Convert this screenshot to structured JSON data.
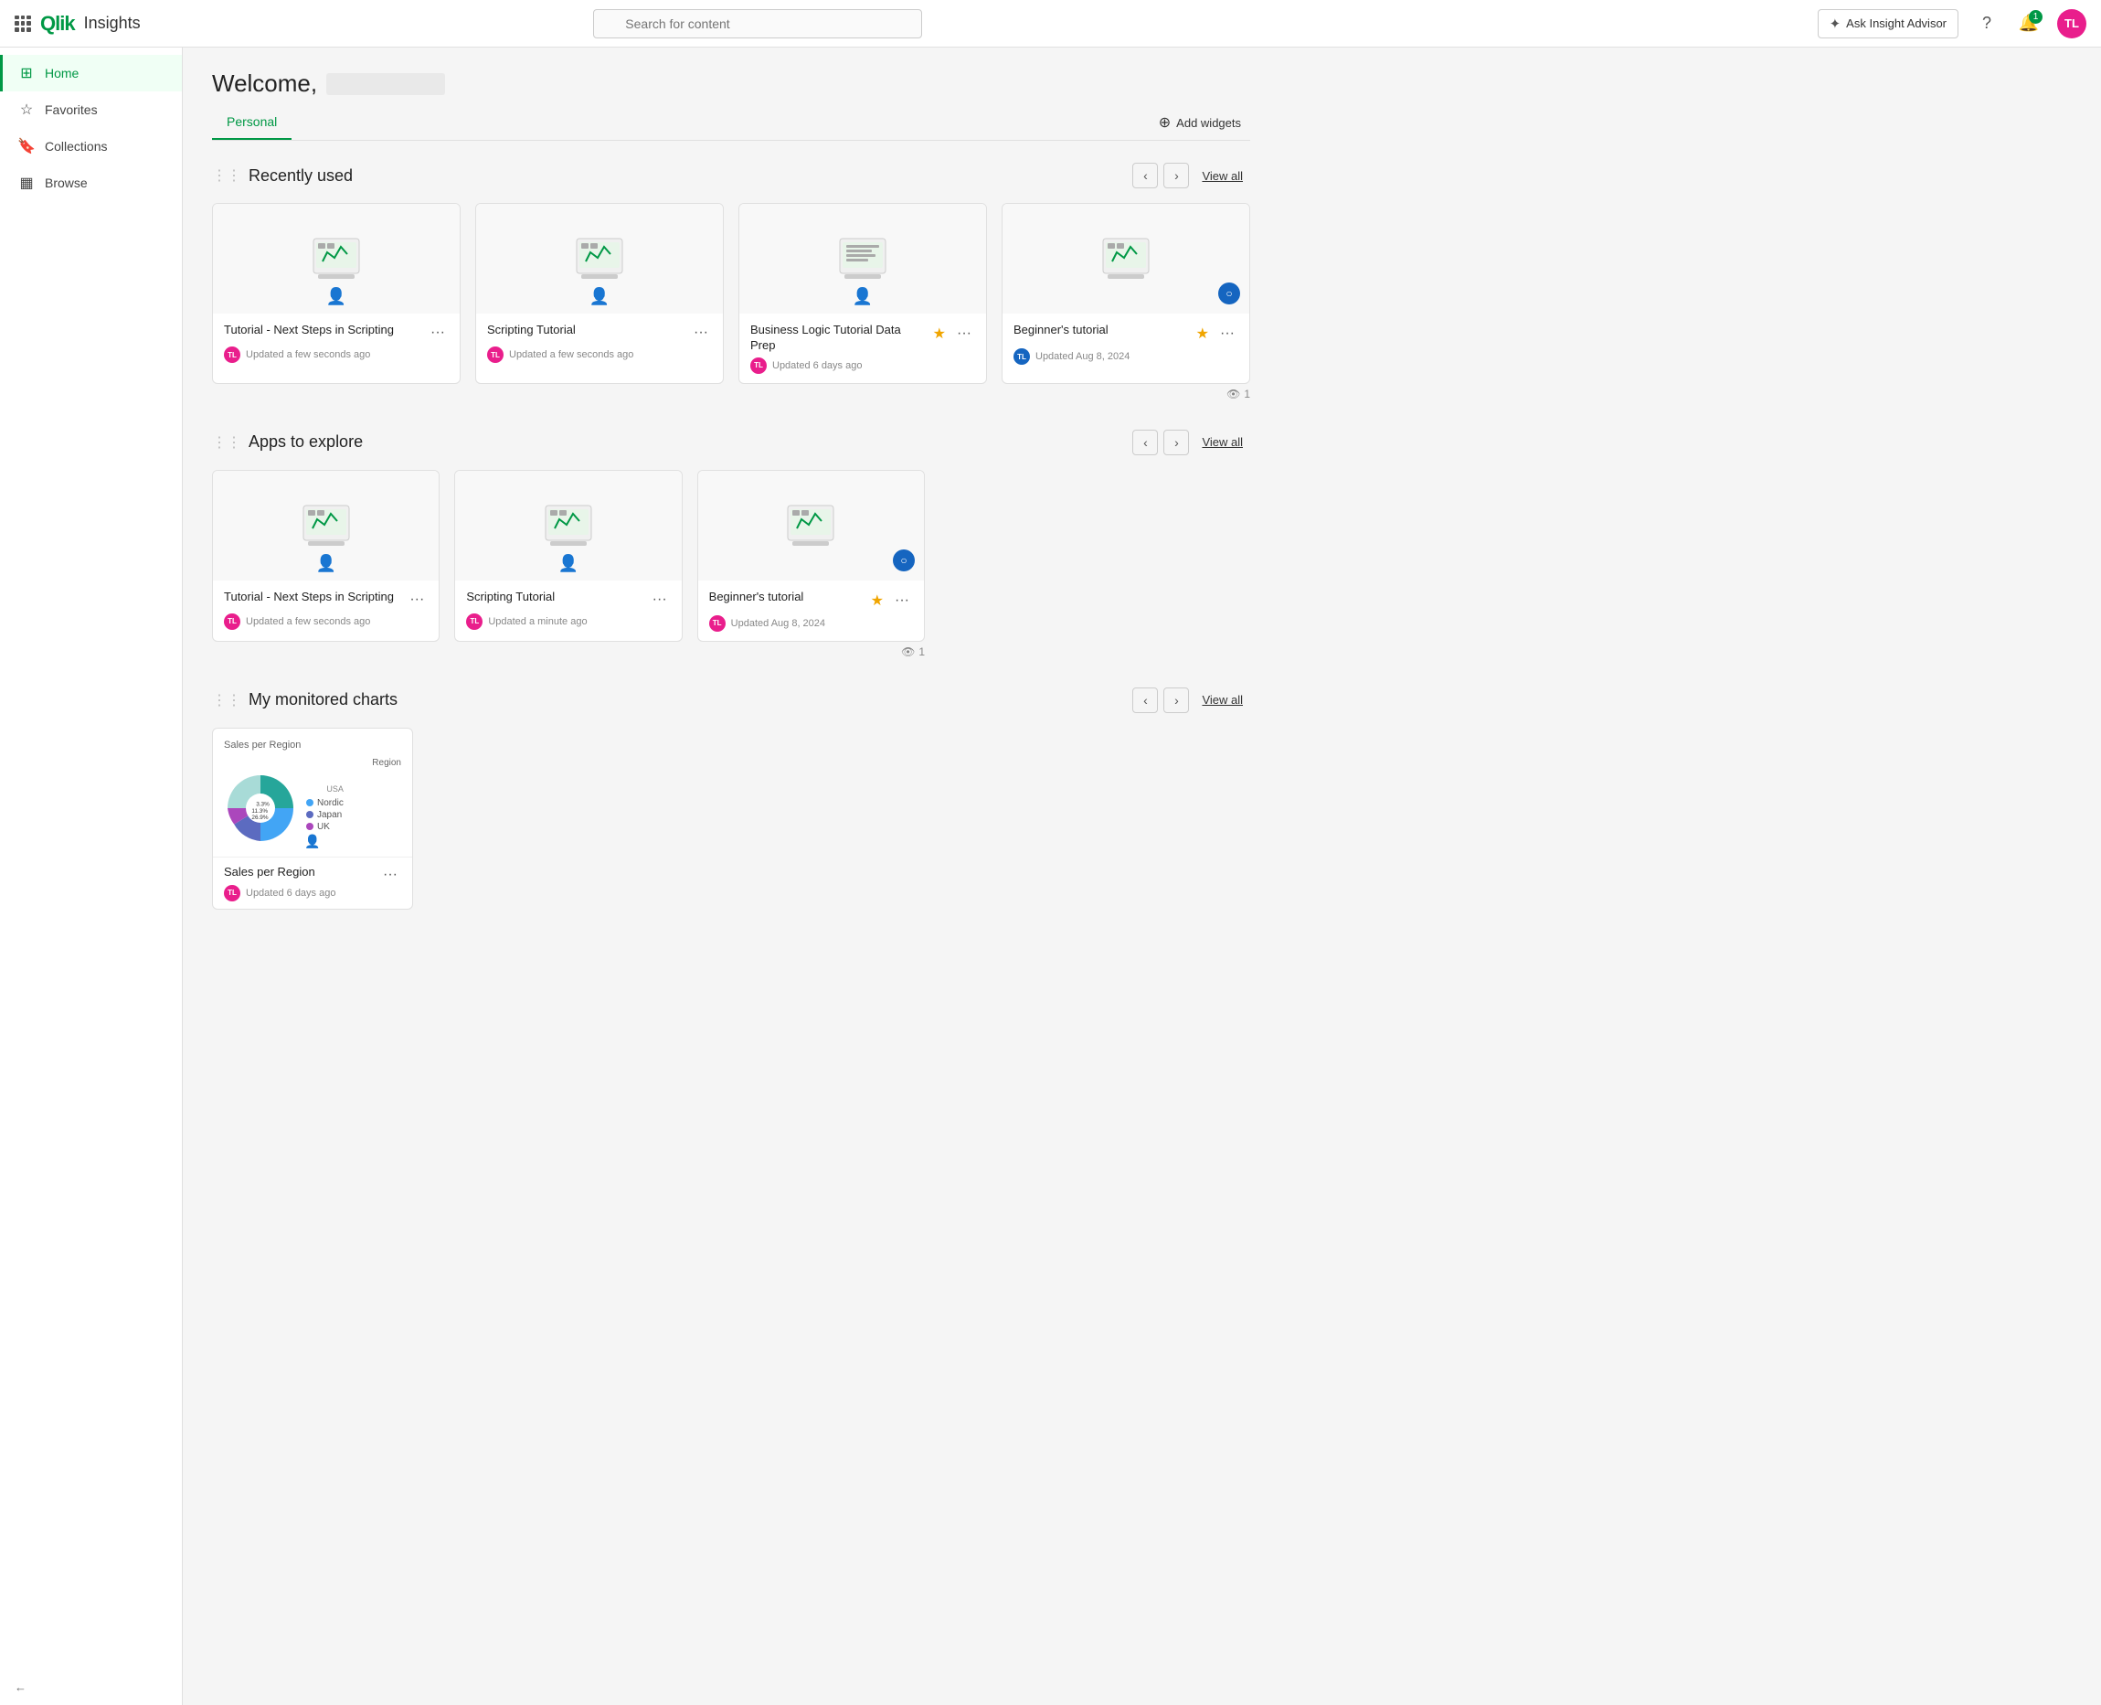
{
  "topbar": {
    "app_title": "Insights",
    "search_placeholder": "Search for content",
    "ask_advisor_label": "Ask Insight Advisor",
    "notif_count": "1",
    "avatar_initials": "TL",
    "help_icon": "question-mark"
  },
  "sidebar": {
    "items": [
      {
        "id": "home",
        "label": "Home",
        "icon": "home",
        "active": true
      },
      {
        "id": "favorites",
        "label": "Favorites",
        "icon": "star"
      },
      {
        "id": "collections",
        "label": "Collections",
        "icon": "bookmark"
      },
      {
        "id": "browse",
        "label": "Browse",
        "icon": "grid"
      }
    ],
    "collapse_label": "Collapse"
  },
  "welcome": {
    "greeting": "Welcome,"
  },
  "tabs": [
    {
      "id": "personal",
      "label": "Personal",
      "active": true
    }
  ],
  "add_widgets_label": "Add widgets",
  "recently_used": {
    "title": "Recently used",
    "view_all": "View all",
    "views_count": "1",
    "cards": [
      {
        "id": "card1",
        "title": "Tutorial - Next Steps in Scripting",
        "updated": "Updated a few seconds ago",
        "avatar_initials": "TL",
        "avatar_color": "pink",
        "starred": false
      },
      {
        "id": "card2",
        "title": "Scripting Tutorial",
        "updated": "Updated a few seconds ago",
        "avatar_initials": "TL",
        "avatar_color": "pink",
        "starred": false
      },
      {
        "id": "card3",
        "title": "Business Logic Tutorial Data Prep",
        "updated": "Updated 6 days ago",
        "avatar_initials": "TL",
        "avatar_color": "pink",
        "starred": true
      },
      {
        "id": "card4",
        "title": "Beginner's tutorial",
        "updated": "Updated Aug 8, 2024",
        "avatar_initials": "TL",
        "avatar_color": "pink",
        "starred": true,
        "has_badge": true
      }
    ]
  },
  "apps_to_explore": {
    "title": "Apps to explore",
    "view_all": "View all",
    "views_count": "1",
    "cards": [
      {
        "id": "app1",
        "title": "Tutorial - Next Steps in Scripting",
        "updated": "Updated a few seconds ago",
        "avatar_initials": "TL",
        "avatar_color": "pink",
        "starred": false
      },
      {
        "id": "app2",
        "title": "Scripting Tutorial",
        "updated": "Updated a minute ago",
        "avatar_initials": "TL",
        "avatar_color": "pink",
        "starred": false
      },
      {
        "id": "app3",
        "title": "Beginner's tutorial",
        "updated": "Updated Aug 8, 2024",
        "avatar_initials": "TL",
        "avatar_color": "pink",
        "starred": true,
        "has_badge": true
      }
    ]
  },
  "monitored_charts": {
    "title": "My monitored charts",
    "view_all": "View all",
    "chart": {
      "title": "Sales per Region",
      "updated": "Updated 6 days ago",
      "avatar_initials": "TL",
      "avatar_color": "pink",
      "chart_label": "Region",
      "segments": [
        {
          "label": "USA",
          "value": 45.5,
          "color": "#26a69a",
          "pct": "45.5%"
        },
        {
          "label": "Nordic",
          "value": 26.9,
          "color": "#42a5f5",
          "pct": "26.9%"
        },
        {
          "label": "Japan",
          "value": 11.3,
          "color": "#5c6bc0",
          "pct": "11.3%"
        },
        {
          "label": "UK",
          "value": 3.3,
          "color": "#ab47bc",
          "pct": "3.3%"
        }
      ],
      "legend_labels": [
        "Nordic",
        "Japan",
        "UK",
        "USA"
      ]
    }
  }
}
